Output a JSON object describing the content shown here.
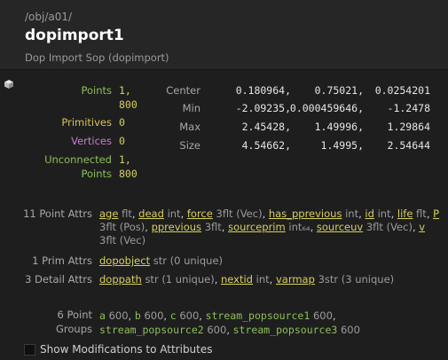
{
  "header": {
    "path": "/obj/a01/",
    "title": "dopimport1",
    "subtitle": "Dop Import Sop (dopimport)"
  },
  "counts": {
    "points_label": "Points",
    "points_value_1": "1,",
    "points_value_2": "800",
    "primitives_label": "Primitives",
    "primitives_value": "0",
    "vertices_label": "Vertices",
    "vertices_value": "0",
    "unconnected_label": "Unconnected",
    "unconnected_value": "1,",
    "unconnected_points_label": "Points",
    "unconnected_points_value": "800"
  },
  "bounds": {
    "center_label": "Center",
    "center": [
      "0.180964,",
      "0.75021,",
      "0.0254201"
    ],
    "min_label": "Min",
    "min": [
      "-2.09235,",
      "0.000459646,",
      "-1.2478"
    ],
    "max_label": "Max",
    "max": [
      "2.45428,",
      "1.49996,",
      "1.29864"
    ],
    "size_label": "Size",
    "size": [
      "4.54662,",
      "1.4995,",
      "2.54644"
    ]
  },
  "point_attrs": {
    "label": "11 Point Attrs",
    "items": [
      {
        "name": "age",
        "type": "flt"
      },
      {
        "name": "dead",
        "type": "int"
      },
      {
        "name": "force",
        "type": "3flt (Vec)"
      },
      {
        "name": "has_pprevious",
        "type": "int"
      },
      {
        "name": "id",
        "type": "int"
      },
      {
        "name": "life",
        "type": "flt"
      },
      {
        "name": "P",
        "type": "3flt (Pos)"
      },
      {
        "name": "pprevious",
        "type": "3flt"
      },
      {
        "name": "sourceprim",
        "type": "int₆₄"
      },
      {
        "name": "sourceuv",
        "type": "3flt (Vec)"
      },
      {
        "name": "v",
        "type": "3flt (Vec)"
      }
    ]
  },
  "prim_attrs": {
    "label": "1 Prim Attrs",
    "items": [
      {
        "name": "dopobject",
        "type": "str (0 unique)"
      }
    ]
  },
  "detail_attrs": {
    "label": "3 Detail Attrs",
    "items": [
      {
        "name": "doppath",
        "type": "str (1 unique)"
      },
      {
        "name": "nextid",
        "type": "int"
      },
      {
        "name": "varmap",
        "type": "3str (3 unique)"
      }
    ]
  },
  "point_groups": {
    "label_1": "6 Point",
    "label_2": "Groups",
    "items": [
      {
        "name": "a",
        "count": "600"
      },
      {
        "name": "b",
        "count": "600"
      },
      {
        "name": "c",
        "count": "600"
      },
      {
        "name": "stream_popsource1",
        "count": "600"
      },
      {
        "name": "stream_popsource2",
        "count": "600"
      },
      {
        "name": "stream_popsource3",
        "count": "600"
      }
    ]
  },
  "footer": {
    "checkbox_label": "Show Modifications to Attributes",
    "checked": false
  }
}
